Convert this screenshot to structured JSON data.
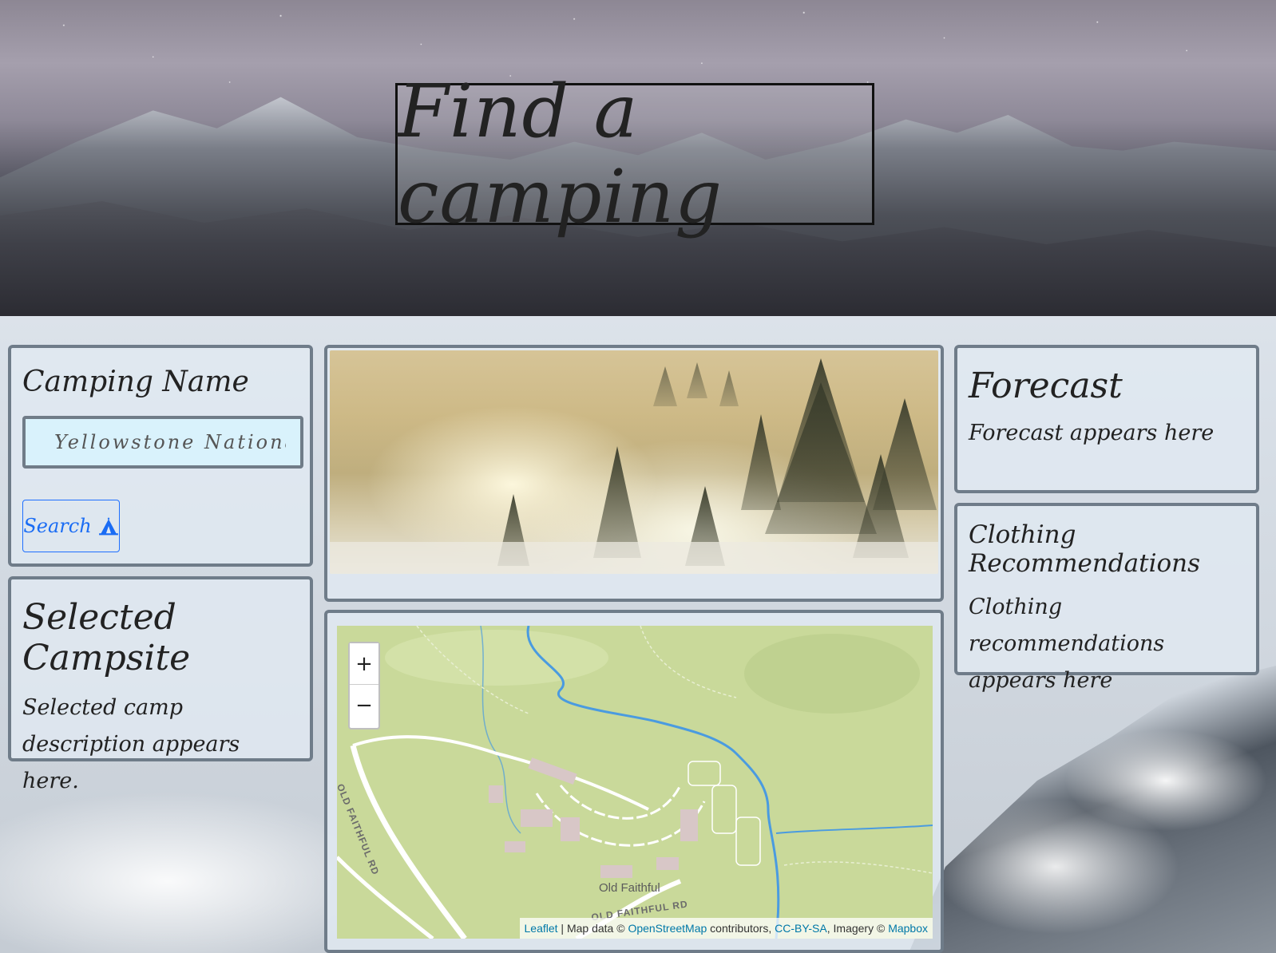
{
  "header": {
    "title": "Find a camping"
  },
  "camping_name": {
    "heading": "Camping Name",
    "input_value": "Yellowstone National Par",
    "search_label": "Search"
  },
  "selected_campsite": {
    "heading": "Selected Campsite",
    "description": "Selected camp description appears here."
  },
  "forecast": {
    "heading": "Forecast",
    "text": "Forecast appears here"
  },
  "clothing": {
    "heading": "Clothing Recommendations",
    "text": "Clothing recommendations appears here"
  },
  "map": {
    "zoom_in": "+",
    "zoom_out": "−",
    "labels": {
      "road_old_faithful_rd": "OLD FAITHFUL RD",
      "place": "Old Faithful",
      "road_bottom": "OLD FAITHFUL RD"
    },
    "attribution": {
      "leaflet": "Leaflet",
      "sep": " | Map data © ",
      "osm": "OpenStreetMap",
      "contrib": " contributors, ",
      "license": "CC-BY-SA",
      "imagery": ", Imagery © ",
      "mapbox": "Mapbox"
    },
    "colors": {
      "land": "#c9d99a",
      "water": "#4a9be0",
      "road": "#ffffff",
      "building": "#d8c7c7"
    }
  },
  "colors": {
    "accent": "#1a6cf4",
    "input_bg": "#d9f2fc",
    "card_border": "#6f7c89"
  }
}
